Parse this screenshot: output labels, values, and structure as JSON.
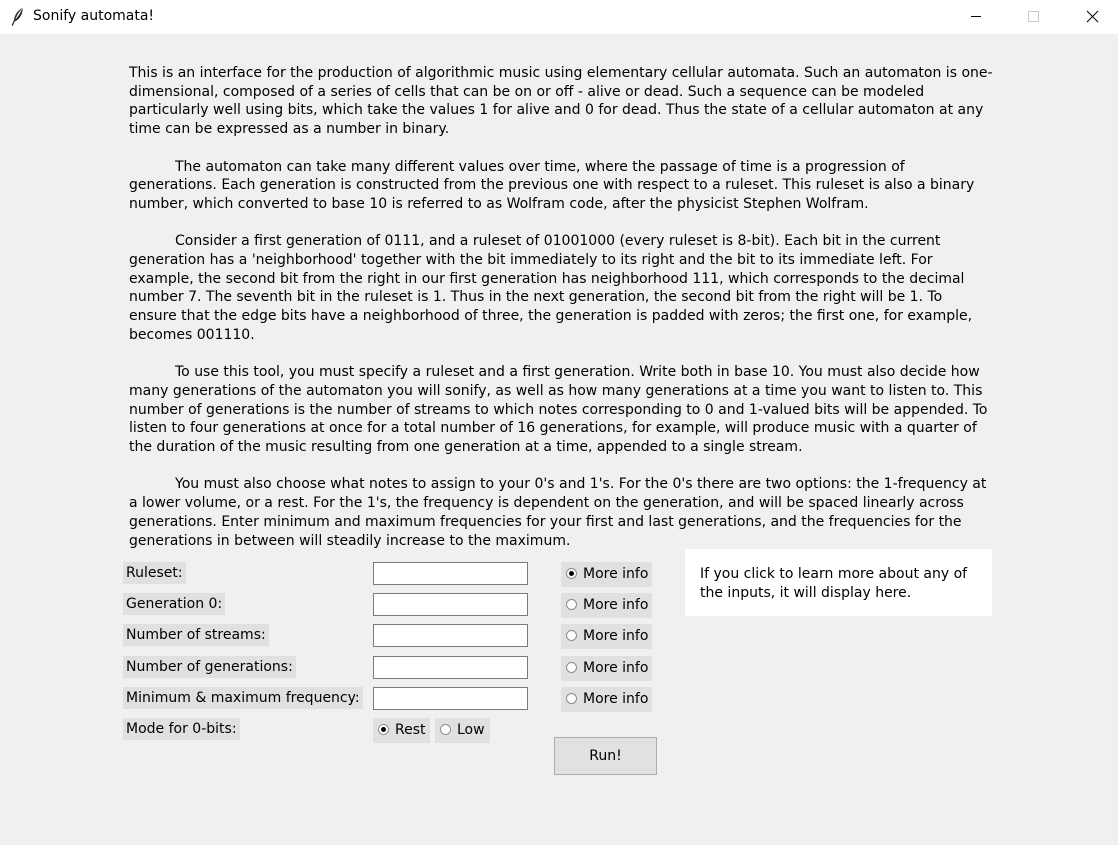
{
  "window": {
    "title": "Sonify automata!",
    "icon": "feather-icon",
    "controls": [
      "minimize-icon",
      "maximize-icon",
      "close-icon"
    ]
  },
  "description": {
    "paragraphs": [
      "This is an interface for the production of algorithmic music using elementary cellular automata. Such an automaton is one-dimensional, composed of a series of cells that can be on or off - alive or dead. Such a sequence can be modeled particularly well using bits, which take the values 1 for alive and 0 for dead. Thus the state of a cellular automaton at any time can be expressed as a number in binary.",
      "The automaton can take many different values over time, where the passage of time is a progression of generations. Each generation is constructed from the previous one with respect to a ruleset. This ruleset is also a binary number, which converted to base 10 is referred to as Wolfram code, after the physicist Stephen Wolfram.",
      "Consider a first generation of 0111, and a ruleset of 01001000 (every ruleset is 8-bit). Each bit in the current generation has a 'neighborhood' together with the bit immediately to its right and the bit to its immediate left. For example, the second bit from the right in our first generation has neighborhood 111, which corresponds to the decimal number 7. The seventh bit in the ruleset is 1. Thus in the next generation, the second bit from the right will be 1. To ensure that the edge bits have a neighborhood of three, the generation is padded with zeros; the first one, for example, becomes 001110.",
      "To use this tool, you must specify a ruleset and a first generation. Write both in base 10. You must also decide how many generations of the automaton you will sonify, as well as how many generations at a time you want to listen to. This number of generations is the number of streams to which notes corresponding to 0 and 1-valued bits will be appended. To listen to four generations at once for a total number of 16 generations, for example, will produce music with a quarter of the duration of the music resulting from one generation at a time, appended to a single stream.",
      "You must also choose what notes to assign to your 0's and 1's. For the 0's there are two options: the 1-frequency at a lower volume, or a rest. For the 1's, the frequency is dependent on the generation, and will be spaced linearly across generations. Enter minimum and maximum frequencies for your first and last generations, and the frequencies for the generations in between will steadily increase to the maximum."
    ]
  },
  "form": {
    "fields": [
      {
        "label": "Ruleset:",
        "value": "",
        "info_label": "More info",
        "info_selected": true
      },
      {
        "label": "Generation 0:",
        "value": "",
        "info_label": "More info",
        "info_selected": false
      },
      {
        "label": "Number of streams:",
        "value": "",
        "info_label": "More info",
        "info_selected": false
      },
      {
        "label": "Number of generations:",
        "value": "",
        "info_label": "More info",
        "info_selected": false
      },
      {
        "label": "Minimum & maximum frequency:",
        "value": "",
        "info_label": "More info",
        "info_selected": false
      }
    ],
    "mode": {
      "label": "Mode for 0-bits:",
      "options": [
        {
          "label": "Rest",
          "selected": true
        },
        {
          "label": "Low",
          "selected": false
        }
      ]
    },
    "run_label": "Run!"
  },
  "info_panel": {
    "text": "If you click to learn more about any of the inputs, it will display here."
  }
}
